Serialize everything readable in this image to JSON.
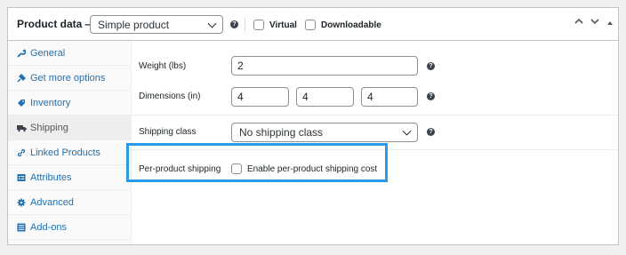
{
  "header": {
    "title": "Product data —",
    "product_type": "Simple product",
    "virtual_label": "Virtual",
    "downloadable_label": "Downloadable",
    "help_icon": "question-circle-icon",
    "controls": [
      "chevron-up-icon",
      "chevron-down-icon",
      "caret-up-icon"
    ]
  },
  "tabs": [
    {
      "label": "General",
      "icon": "wrench-icon",
      "active": false
    },
    {
      "label": "Get more options",
      "icon": "plugin-icon",
      "active": false
    },
    {
      "label": "Inventory",
      "icon": "tag-icon",
      "active": false
    },
    {
      "label": "Shipping",
      "icon": "truck-icon",
      "active": true
    },
    {
      "label": "Linked Products",
      "icon": "link-icon",
      "active": false
    },
    {
      "label": "Attributes",
      "icon": "list-icon",
      "active": false
    },
    {
      "label": "Advanced",
      "icon": "gear-icon",
      "active": false
    },
    {
      "label": "Add-ons",
      "icon": "form-icon",
      "active": false
    }
  ],
  "shipping": {
    "weight_label": "Weight (lbs)",
    "weight_value": "2",
    "dimensions_label": "Dimensions (in)",
    "length": "4",
    "width": "4",
    "height": "4",
    "class_label": "Shipping class",
    "class_value": "No shipping class",
    "per_product_label": "Per-product shipping",
    "per_product_checkbox_label": "Enable per-product shipping cost"
  },
  "colors": {
    "link": "#2271b1",
    "highlight": "#2a9ae6"
  }
}
